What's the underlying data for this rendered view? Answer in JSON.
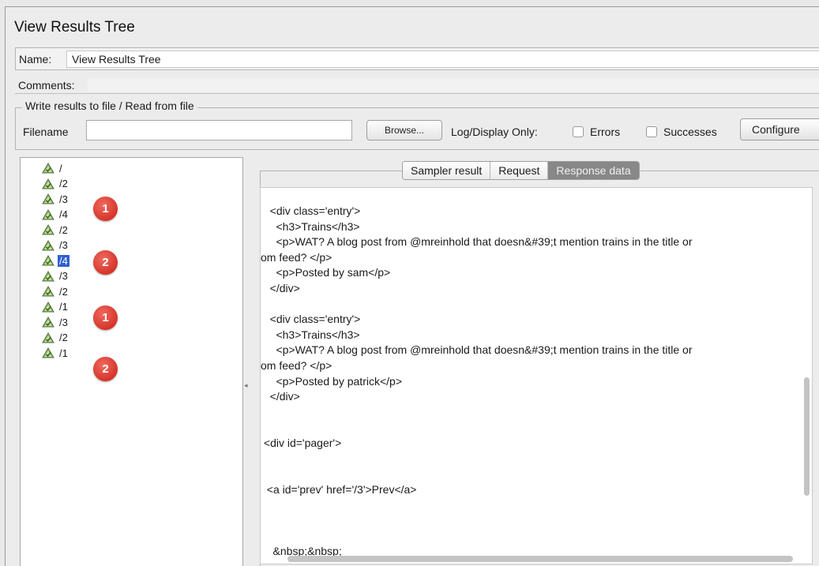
{
  "window": {
    "title": "View Results Tree"
  },
  "form": {
    "name_label": "Name:",
    "name_value": "View Results Tree",
    "comments_label": "Comments:",
    "group_title": "Write results to file / Read from file",
    "filename_label": "Filename",
    "filename_value": "",
    "browse_label": "Browse...",
    "log_display_label": "Log/Display Only:",
    "errors_label": "Errors",
    "errors_checked": false,
    "successes_label": "Successes",
    "successes_checked": false,
    "configure_label": "Configure"
  },
  "tree": {
    "icon": "success-triangle-icon",
    "items": [
      {
        "label": "/"
      },
      {
        "label": "/2"
      },
      {
        "label": "/3"
      },
      {
        "label": "/4"
      },
      {
        "label": "/2"
      },
      {
        "label": "/3"
      },
      {
        "label": "/4",
        "selected": true
      },
      {
        "label": "/3"
      },
      {
        "label": "/2"
      },
      {
        "label": "/1"
      },
      {
        "label": "/3"
      },
      {
        "label": "/2"
      },
      {
        "label": "/1"
      }
    ],
    "badges": [
      "1",
      "2",
      "1",
      "2"
    ]
  },
  "tabs": [
    {
      "label": "Sampler result",
      "active": false
    },
    {
      "label": "Request",
      "active": false
    },
    {
      "label": "Response data",
      "active": true
    }
  ],
  "response_lines": [
    "   <div class='entry'>",
    "     <h3>Trains</h3>",
    "     <p>WAT? A blog post from @mreinhold that doesn&#39;t mention trains in the title or",
    "om feed? </p>",
    "     <p>Posted by sam</p>",
    "   </div>",
    "",
    "   <div class='entry'>",
    "     <h3>Trains</h3>",
    "     <p>WAT? A blog post from @mreinhold that doesn&#39;t mention trains in the title or",
    "om feed? </p>",
    "     <p>Posted by patrick</p>",
    "   </div>",
    "",
    "",
    " <div id='pager'>",
    "",
    "",
    "  <a id='prev' href='/3'>Prev</a>",
    "",
    "",
    "",
    "    &nbsp;&nbsp;"
  ],
  "colors": {
    "selection": "#2f5fd0",
    "badge": "#d6342a",
    "active_tab": "#888888"
  }
}
